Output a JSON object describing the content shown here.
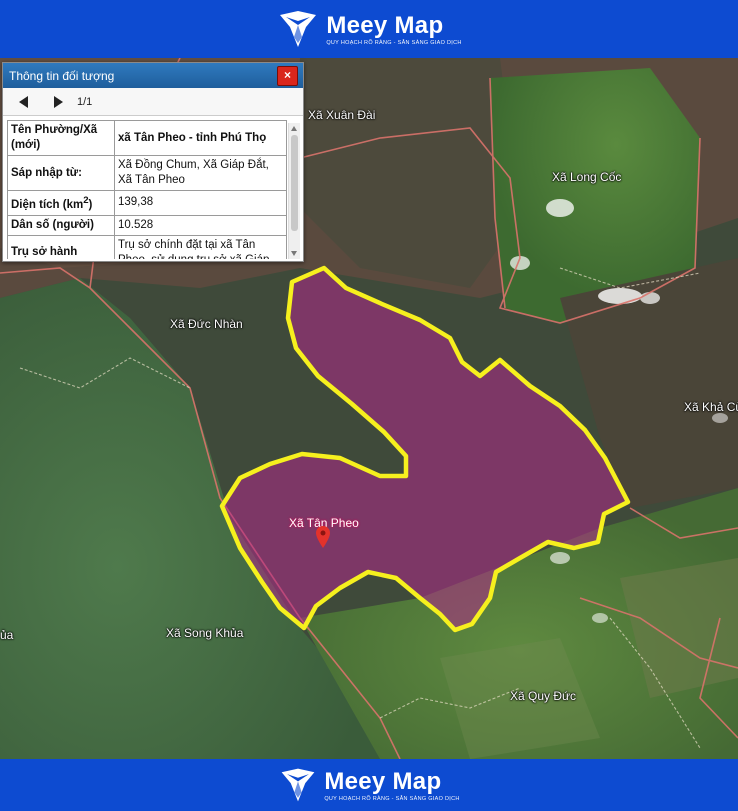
{
  "brand": {
    "name": "Meey Map",
    "tagline": "QUY HOẠCH RÕ RÀNG - SẴN SÀNG GIAO DỊCH"
  },
  "popup": {
    "title": "Thông tin đối tượng",
    "close_label": "×",
    "pager_text": "1/1",
    "rows": [
      {
        "label": "Tên Phường/Xã (mới)",
        "value": "xã Tân Pheo - tỉnh Phú Thọ"
      },
      {
        "label": "Sáp nhập từ:",
        "value": "Xã Đồng Chum, Xã Giáp Đắt, Xã Tân Pheo"
      },
      {
        "label": "Diện tích (km",
        "label_sup": "2",
        "label_end": ")",
        "value": "139,38"
      },
      {
        "label": "Dân số (người)",
        "value": "10.528"
      },
      {
        "label": "Trụ sở hành chính (mới)",
        "value": "Trụ sở chính đặt tại xã Tân Pheo, sử dụng trụ sở xã Giáp Đắt"
      }
    ]
  },
  "map": {
    "labels": {
      "xuan_dai": "Xã Xuân Đài",
      "long_coc": "Xã Long Cốc",
      "duc_nhan": "Xã Đức Nhàn",
      "khac": "Xã Khả Cử",
      "song_khua": "Xã Song Khủa",
      "quy_duc": "Xã Quy Đức",
      "left_edge": "ủa",
      "selected": "Xã Tân Pheo"
    },
    "colors": {
      "highlight_fill": "#b0288a",
      "highlight_stroke": "#f6f01e",
      "banner": "#0d4bd1"
    }
  }
}
